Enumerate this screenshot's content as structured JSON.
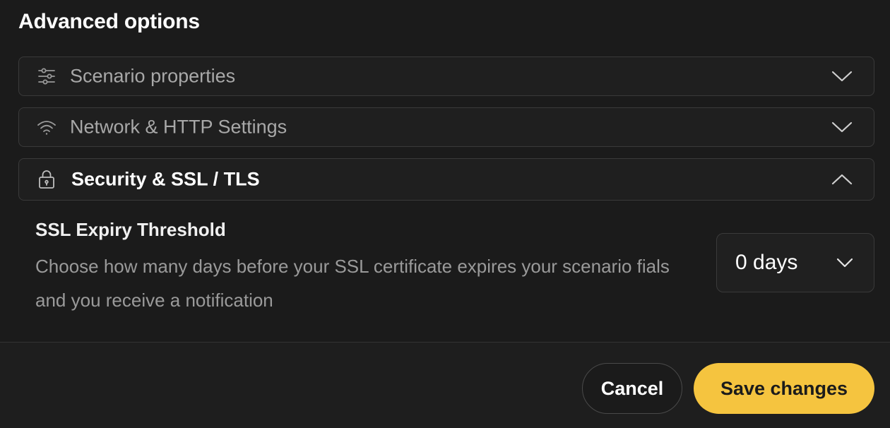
{
  "title": "Advanced options",
  "sections": [
    {
      "label": "Scenario properties",
      "icon": "sliders-icon",
      "expanded": false
    },
    {
      "label": "Network & HTTP Settings",
      "icon": "wifi-icon",
      "expanded": false
    },
    {
      "label": "Security & SSL / TLS",
      "icon": "lock-icon",
      "expanded": true
    }
  ],
  "ssl_setting": {
    "title": "SSL Expiry Threshold",
    "description": "Choose how many days before your SSL certificate expires your scenario fials and you receive a notification",
    "selected_value": "0 days"
  },
  "footer": {
    "cancel_label": "Cancel",
    "save_label": "Save changes"
  },
  "colors": {
    "background": "#1b1b1b",
    "accent": "#f5c43f"
  }
}
